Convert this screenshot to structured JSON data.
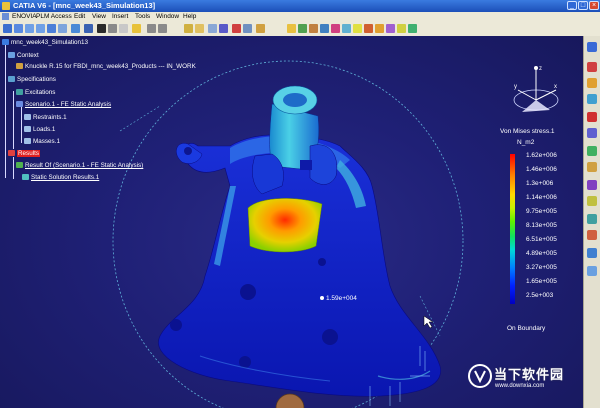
{
  "window": {
    "title": "CATIA V6 - [mnc_week43_Simulation13]"
  },
  "menu": {
    "items": [
      "ENOVIA",
      "PLM Access",
      "Edit",
      "View",
      "Insert",
      "Tools",
      "Window",
      "Help"
    ]
  },
  "tree": {
    "root": "mnc_week43_Simulation13",
    "context": "Context",
    "product": "Knuckle R.15 for FBDI_mnc_week43_Products --- IN_WORK",
    "specifications": "Specifications",
    "excitations": "Excitations",
    "scenario": "Scenario.1 - FE Static Analysis",
    "restraints": "Restraints.1",
    "loads": "Loads.1",
    "masses": "Masses.1",
    "results": "Results",
    "result_of": "Result Of (Scenario.1 - FE Static Analysis)",
    "static_results": "Static Solution Results.1"
  },
  "legend": {
    "title": "Von Mises stress.1",
    "unit": "N_m2",
    "values": [
      "1.62e+006",
      "1.46e+006",
      "1.3e+006",
      "1.14e+006",
      "9.75e+005",
      "8.13e+005",
      "6.51e+005",
      "4.89e+005",
      "3.27e+005",
      "1.65e+005",
      "2.5e+003"
    ],
    "footer": "On Boundary",
    "colors": [
      "#ff0000",
      "#ff8000",
      "#ffd800",
      "#60f000",
      "#00d8d8",
      "#0080ff",
      "#0000c0"
    ]
  },
  "viewport": {
    "probe_value": "1.59e+004"
  },
  "watermark": {
    "text": "当下软件园",
    "url": "www.downxia.com"
  },
  "compass": {
    "x_label": "x",
    "y_label": "y",
    "z_label": "z"
  }
}
